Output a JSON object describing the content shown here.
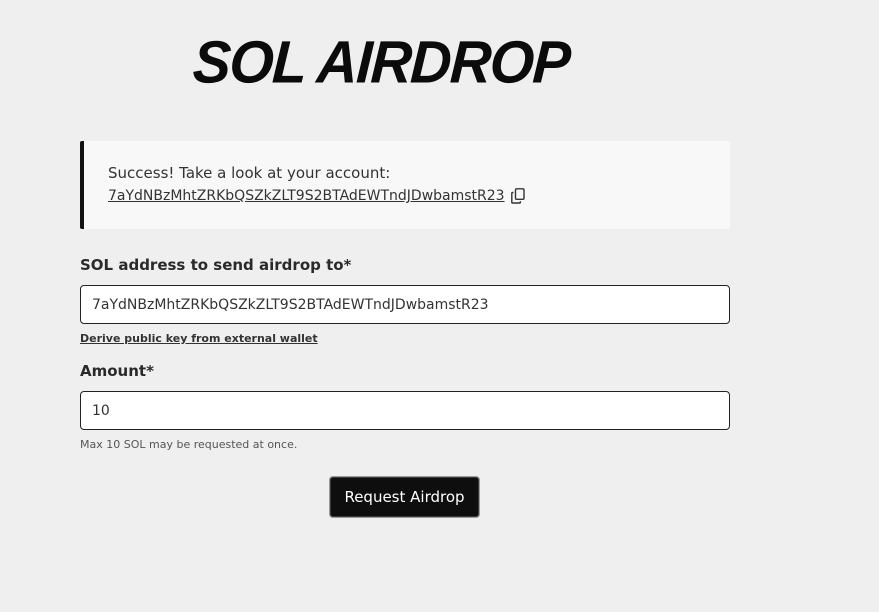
{
  "header": {
    "title": "SOL AIRDROP"
  },
  "notice": {
    "message": "Success! Take a look at your account:",
    "account_link": "7aYdNBzMhtZRKbQSZkZLT9S2BTAdEWTndJDwbamstR23",
    "copy_icon": "copy-icon"
  },
  "form": {
    "address_label": "SOL address to send airdrop to*",
    "address_value": "7aYdNBzMhtZRKbQSZkZLT9S2BTAdEWTndJDwbamstR23",
    "derive_link": "Derive public key from external wallet",
    "amount_label": "Amount*",
    "amount_value": "10",
    "amount_hint": "Max 10 SOL may be requested at once.",
    "submit_label": "Request Airdrop"
  },
  "colors": {
    "background": "#efefef",
    "notice_background": "#f8f8f8",
    "notice_border": "#111111",
    "button_background": "#0e0e0e",
    "button_text": "#ffffff"
  }
}
